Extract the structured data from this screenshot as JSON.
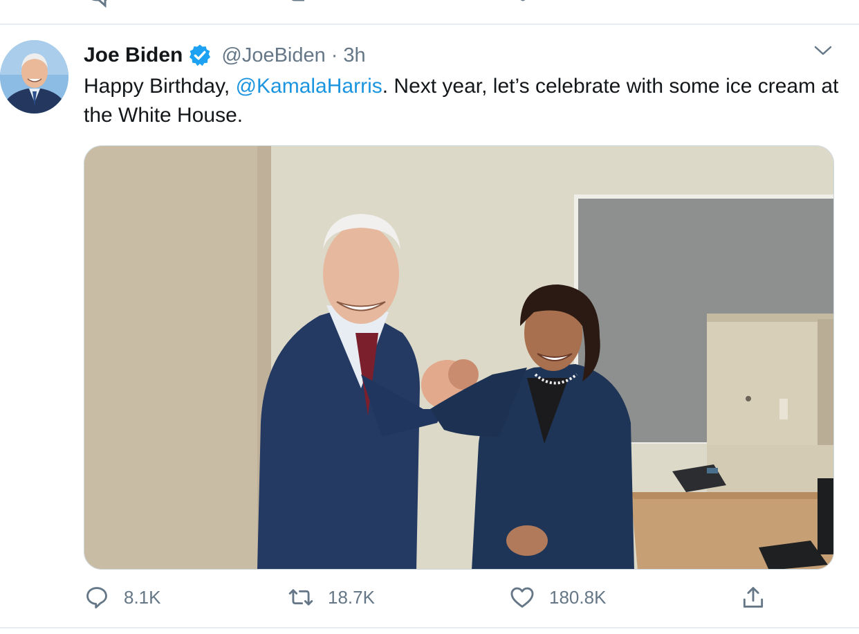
{
  "tweet": {
    "author_name": "Joe Biden",
    "handle": "@JoeBiden",
    "separator": "·",
    "time": "3h",
    "text_before": "Happy Birthday, ",
    "mention": "@KamalaHarris",
    "text_after": ". Next year, let’s celebrate with some ice cream at the White House."
  },
  "actions": {
    "replies": "8.1K",
    "retweets": "18.7K",
    "likes": "180.8K"
  },
  "icons": {
    "verified": "verified-badge-icon",
    "caret": "chevron-down-icon",
    "reply": "reply-icon",
    "retweet": "retweet-icon",
    "like": "heart-icon",
    "share": "share-icon"
  },
  "colors": {
    "link": "#1b95e0",
    "secondary_text": "#657786",
    "divider": "#e6ecf0"
  }
}
